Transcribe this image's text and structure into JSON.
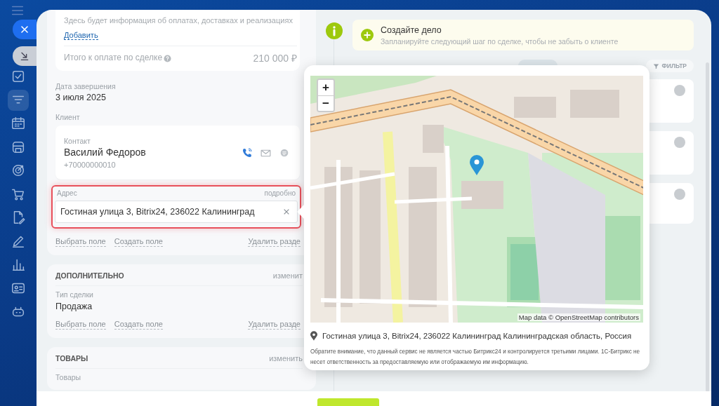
{
  "sidebar": {
    "items": [
      {
        "selected": false
      },
      {
        "selected": true
      },
      {
        "selected": false
      },
      {
        "selected": false
      },
      {
        "selected": false
      },
      {
        "selected": false
      },
      {
        "selected": false
      },
      {
        "selected": false
      },
      {
        "selected": false
      },
      {
        "selected": false
      },
      {
        "selected": false
      }
    ]
  },
  "deal": {
    "payments": {
      "info": "Здесь будет информация об оплатах, доставках и реализациях",
      "add_link": "Добавить",
      "total_label": "Итого к оплате по сделке",
      "total_value": "210 000 ₽"
    },
    "close_date": {
      "label": "Дата завершения",
      "value": "3 июля 2025"
    },
    "client": {
      "label": "Клиент",
      "contact": {
        "label": "Контакт",
        "name": "Василий Федоров",
        "phone": "+70000000010"
      }
    },
    "address": {
      "label": "Адрес",
      "details_link": "подробно",
      "value": "Гостиная улица 3, Bitrix24, 236022 Калининград",
      "highlighted": true
    },
    "links": [
      "Выбрать поле",
      "Создать поле",
      "Удалить разде"
    ],
    "sections": [
      {
        "title": "ДОПОЛНИТЕЛЬНО",
        "edit_link": "изменит",
        "fields": [
          {
            "label": "Тип сделки",
            "value": "Продажа"
          }
        ],
        "links": [
          "Выбрать поле",
          "Создать поле",
          "Удалить разде"
        ]
      },
      {
        "title": "ТОВАРЫ",
        "edit_link": "изменить",
        "fields": [
          {
            "label": "Товары"
          }
        ]
      }
    ]
  },
  "timeline": {
    "create_task": {
      "title": "Создайте дело",
      "hint": "Запланируйте следующий шаг по сделке, чтобы не забыть о клиенте"
    },
    "filter": "ФИЛЬТР",
    "entries": [
      {
        "avatar": true
      },
      {
        "avatar": true
      },
      {
        "avatar": true
      }
    ]
  },
  "map_popup": {
    "zoom_in": "+",
    "zoom_out": "−",
    "attribution": "Map data © OpenStreetMap contributors",
    "address": "Гостиная улица 3, Bitrix24, 236022 Калининград Калининградская область, Россия",
    "disclaimer": "Обратите внимание, что данный сервис не является частью Битрикс24 и контролируется третьими лицами. 1С-Битрикс не несет ответственность за предоставляемую или отображаемую им информацию."
  }
}
